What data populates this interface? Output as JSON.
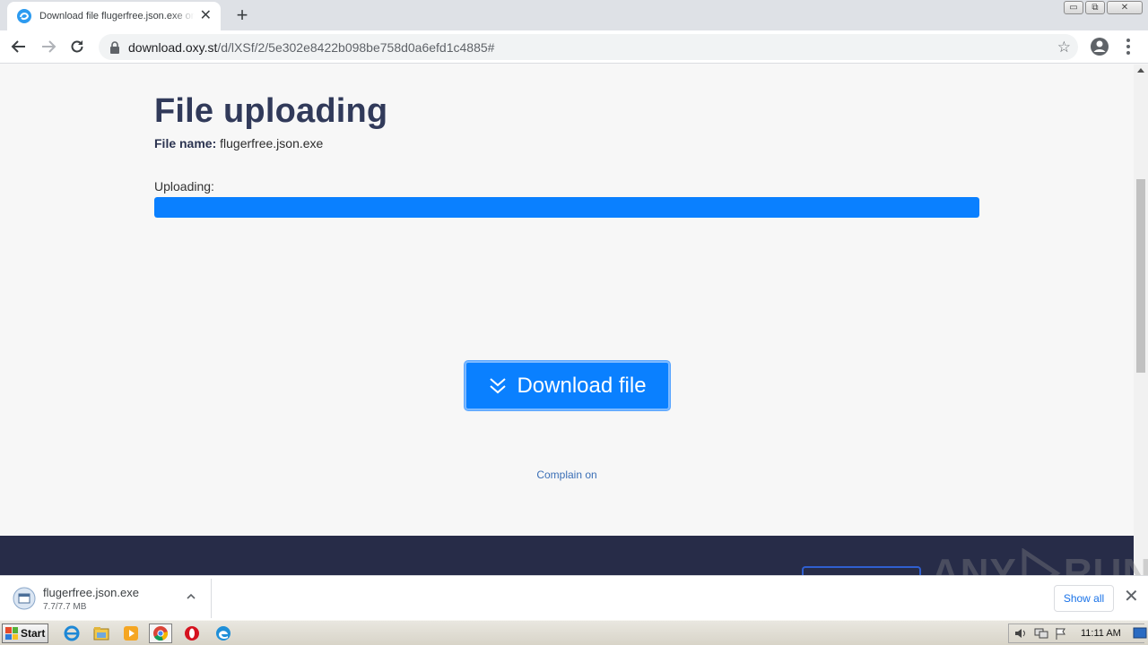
{
  "browser": {
    "tab": {
      "title": "Download file flugerfree.json.exe on oxy.st"
    },
    "window_controls": {
      "minimize": "▭",
      "restore": "⧉",
      "close": "✕"
    },
    "url": {
      "host": "download.oxy.st",
      "path": "/d/lXSf/2/5e302e8422b098be758d0a6efd1c4885#"
    }
  },
  "page": {
    "title": "File uploading",
    "file_label": "File name:",
    "file_name": "flugerfree.json.exe",
    "uploading_label": "Uploading:",
    "progress_fraction": 1.0,
    "download_button": "Download file",
    "complain_link": "Complain on"
  },
  "watermark": {
    "left": "ANY",
    "right": "RUN"
  },
  "downloads_shelf": {
    "item_name": "flugerfree.json.exe",
    "item_size": "7.7/7.7 MB",
    "show_all": "Show all"
  },
  "taskbar": {
    "start_label": "Start",
    "clock": "11:11 AM"
  },
  "colors": {
    "accent": "#0a80ff",
    "title": "#313a5a",
    "footer": "#272c48",
    "link": "#3b6fb6"
  },
  "icons": [
    "chrome-back-icon",
    "forward-icon",
    "reload-icon",
    "lock-icon",
    "star-icon",
    "profile-icon",
    "menu-icon",
    "double-chevron-down-icon",
    "file-icon",
    "chevron-up-icon",
    "close-icon",
    "ie-icon",
    "explorer-icon",
    "media-player-icon",
    "chrome-icon",
    "opera-icon",
    "edge-icon"
  ]
}
